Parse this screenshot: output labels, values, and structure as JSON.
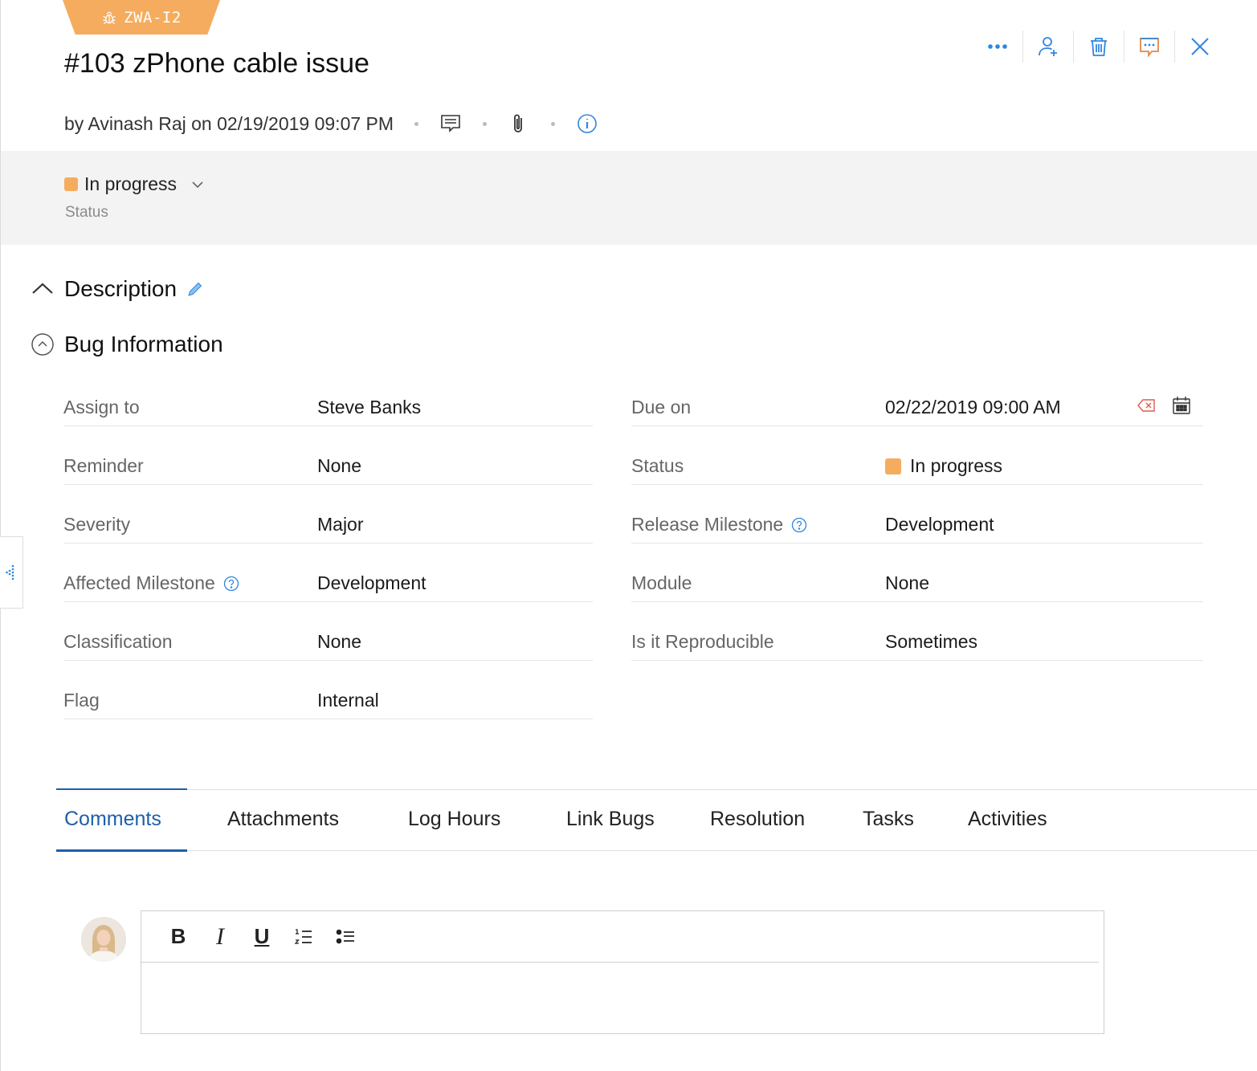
{
  "issue": {
    "tag": "ZWA-I2",
    "title": "#103 zPhone cable issue",
    "meta_text": "by Avinash Raj on 02/19/2019 09:07 PM"
  },
  "status": {
    "value": "In progress",
    "caption": "Status",
    "color": "#f5ac5e"
  },
  "sections": {
    "description": "Description",
    "bug_info": "Bug Information"
  },
  "fields_left": [
    {
      "label": "Assign to",
      "value": "Steve Banks"
    },
    {
      "label": "Reminder",
      "value": "None"
    },
    {
      "label": "Severity",
      "value": "Major"
    },
    {
      "label": "Affected Milestone",
      "value": "Development"
    },
    {
      "label": "Classification",
      "value": "None"
    },
    {
      "label": "Flag",
      "value": "Internal"
    }
  ],
  "fields_right": [
    {
      "label": "Due on",
      "value": "02/22/2019 09:00 AM"
    },
    {
      "label": "Status",
      "value": "In progress"
    },
    {
      "label": "Release Milestone",
      "value": "Development"
    },
    {
      "label": "Module",
      "value": "None"
    },
    {
      "label": "Is it Reproducible",
      "value": "Sometimes"
    }
  ],
  "tabs": [
    {
      "label": "Comments"
    },
    {
      "label": "Attachments"
    },
    {
      "label": "Log Hours"
    },
    {
      "label": "Link Bugs"
    },
    {
      "label": "Resolution"
    },
    {
      "label": "Tasks"
    },
    {
      "label": "Activities"
    }
  ],
  "editor": {
    "bold": "B",
    "italic": "I",
    "underline": "U"
  },
  "colors": {
    "accent": "#1e5fa8",
    "icon_blue": "#2f86e0",
    "badge": "#f5ac5e"
  }
}
